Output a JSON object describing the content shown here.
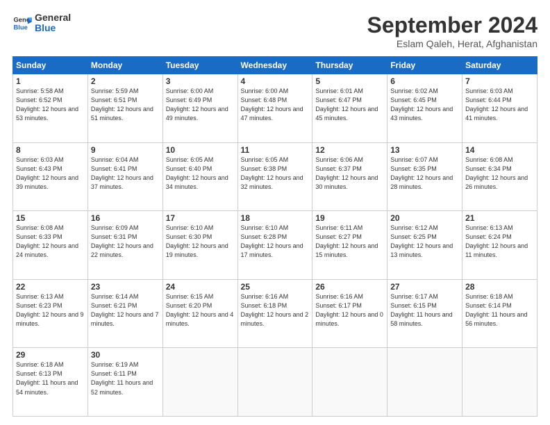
{
  "header": {
    "logo_line1": "General",
    "logo_line2": "Blue",
    "month_title": "September 2024",
    "location": "Eslam Qaleh, Herat, Afghanistan"
  },
  "days_of_week": [
    "Sunday",
    "Monday",
    "Tuesday",
    "Wednesday",
    "Thursday",
    "Friday",
    "Saturday"
  ],
  "weeks": [
    [
      {
        "day": "1",
        "sunrise": "Sunrise: 5:58 AM",
        "sunset": "Sunset: 6:52 PM",
        "daylight": "Daylight: 12 hours and 53 minutes."
      },
      {
        "day": "2",
        "sunrise": "Sunrise: 5:59 AM",
        "sunset": "Sunset: 6:51 PM",
        "daylight": "Daylight: 12 hours and 51 minutes."
      },
      {
        "day": "3",
        "sunrise": "Sunrise: 6:00 AM",
        "sunset": "Sunset: 6:49 PM",
        "daylight": "Daylight: 12 hours and 49 minutes."
      },
      {
        "day": "4",
        "sunrise": "Sunrise: 6:00 AM",
        "sunset": "Sunset: 6:48 PM",
        "daylight": "Daylight: 12 hours and 47 minutes."
      },
      {
        "day": "5",
        "sunrise": "Sunrise: 6:01 AM",
        "sunset": "Sunset: 6:47 PM",
        "daylight": "Daylight: 12 hours and 45 minutes."
      },
      {
        "day": "6",
        "sunrise": "Sunrise: 6:02 AM",
        "sunset": "Sunset: 6:45 PM",
        "daylight": "Daylight: 12 hours and 43 minutes."
      },
      {
        "day": "7",
        "sunrise": "Sunrise: 6:03 AM",
        "sunset": "Sunset: 6:44 PM",
        "daylight": "Daylight: 12 hours and 41 minutes."
      }
    ],
    [
      {
        "day": "8",
        "sunrise": "Sunrise: 6:03 AM",
        "sunset": "Sunset: 6:43 PM",
        "daylight": "Daylight: 12 hours and 39 minutes."
      },
      {
        "day": "9",
        "sunrise": "Sunrise: 6:04 AM",
        "sunset": "Sunset: 6:41 PM",
        "daylight": "Daylight: 12 hours and 37 minutes."
      },
      {
        "day": "10",
        "sunrise": "Sunrise: 6:05 AM",
        "sunset": "Sunset: 6:40 PM",
        "daylight": "Daylight: 12 hours and 34 minutes."
      },
      {
        "day": "11",
        "sunrise": "Sunrise: 6:05 AM",
        "sunset": "Sunset: 6:38 PM",
        "daylight": "Daylight: 12 hours and 32 minutes."
      },
      {
        "day": "12",
        "sunrise": "Sunrise: 6:06 AM",
        "sunset": "Sunset: 6:37 PM",
        "daylight": "Daylight: 12 hours and 30 minutes."
      },
      {
        "day": "13",
        "sunrise": "Sunrise: 6:07 AM",
        "sunset": "Sunset: 6:35 PM",
        "daylight": "Daylight: 12 hours and 28 minutes."
      },
      {
        "day": "14",
        "sunrise": "Sunrise: 6:08 AM",
        "sunset": "Sunset: 6:34 PM",
        "daylight": "Daylight: 12 hours and 26 minutes."
      }
    ],
    [
      {
        "day": "15",
        "sunrise": "Sunrise: 6:08 AM",
        "sunset": "Sunset: 6:33 PM",
        "daylight": "Daylight: 12 hours and 24 minutes."
      },
      {
        "day": "16",
        "sunrise": "Sunrise: 6:09 AM",
        "sunset": "Sunset: 6:31 PM",
        "daylight": "Daylight: 12 hours and 22 minutes."
      },
      {
        "day": "17",
        "sunrise": "Sunrise: 6:10 AM",
        "sunset": "Sunset: 6:30 PM",
        "daylight": "Daylight: 12 hours and 19 minutes."
      },
      {
        "day": "18",
        "sunrise": "Sunrise: 6:10 AM",
        "sunset": "Sunset: 6:28 PM",
        "daylight": "Daylight: 12 hours and 17 minutes."
      },
      {
        "day": "19",
        "sunrise": "Sunrise: 6:11 AM",
        "sunset": "Sunset: 6:27 PM",
        "daylight": "Daylight: 12 hours and 15 minutes."
      },
      {
        "day": "20",
        "sunrise": "Sunrise: 6:12 AM",
        "sunset": "Sunset: 6:25 PM",
        "daylight": "Daylight: 12 hours and 13 minutes."
      },
      {
        "day": "21",
        "sunrise": "Sunrise: 6:13 AM",
        "sunset": "Sunset: 6:24 PM",
        "daylight": "Daylight: 12 hours and 11 minutes."
      }
    ],
    [
      {
        "day": "22",
        "sunrise": "Sunrise: 6:13 AM",
        "sunset": "Sunset: 6:23 PM",
        "daylight": "Daylight: 12 hours and 9 minutes."
      },
      {
        "day": "23",
        "sunrise": "Sunrise: 6:14 AM",
        "sunset": "Sunset: 6:21 PM",
        "daylight": "Daylight: 12 hours and 7 minutes."
      },
      {
        "day": "24",
        "sunrise": "Sunrise: 6:15 AM",
        "sunset": "Sunset: 6:20 PM",
        "daylight": "Daylight: 12 hours and 4 minutes."
      },
      {
        "day": "25",
        "sunrise": "Sunrise: 6:16 AM",
        "sunset": "Sunset: 6:18 PM",
        "daylight": "Daylight: 12 hours and 2 minutes."
      },
      {
        "day": "26",
        "sunrise": "Sunrise: 6:16 AM",
        "sunset": "Sunset: 6:17 PM",
        "daylight": "Daylight: 12 hours and 0 minutes."
      },
      {
        "day": "27",
        "sunrise": "Sunrise: 6:17 AM",
        "sunset": "Sunset: 6:15 PM",
        "daylight": "Daylight: 11 hours and 58 minutes."
      },
      {
        "day": "28",
        "sunrise": "Sunrise: 6:18 AM",
        "sunset": "Sunset: 6:14 PM",
        "daylight": "Daylight: 11 hours and 56 minutes."
      }
    ],
    [
      {
        "day": "29",
        "sunrise": "Sunrise: 6:18 AM",
        "sunset": "Sunset: 6:13 PM",
        "daylight": "Daylight: 11 hours and 54 minutes."
      },
      {
        "day": "30",
        "sunrise": "Sunrise: 6:19 AM",
        "sunset": "Sunset: 6:11 PM",
        "daylight": "Daylight: 11 hours and 52 minutes."
      },
      null,
      null,
      null,
      null,
      null
    ]
  ]
}
